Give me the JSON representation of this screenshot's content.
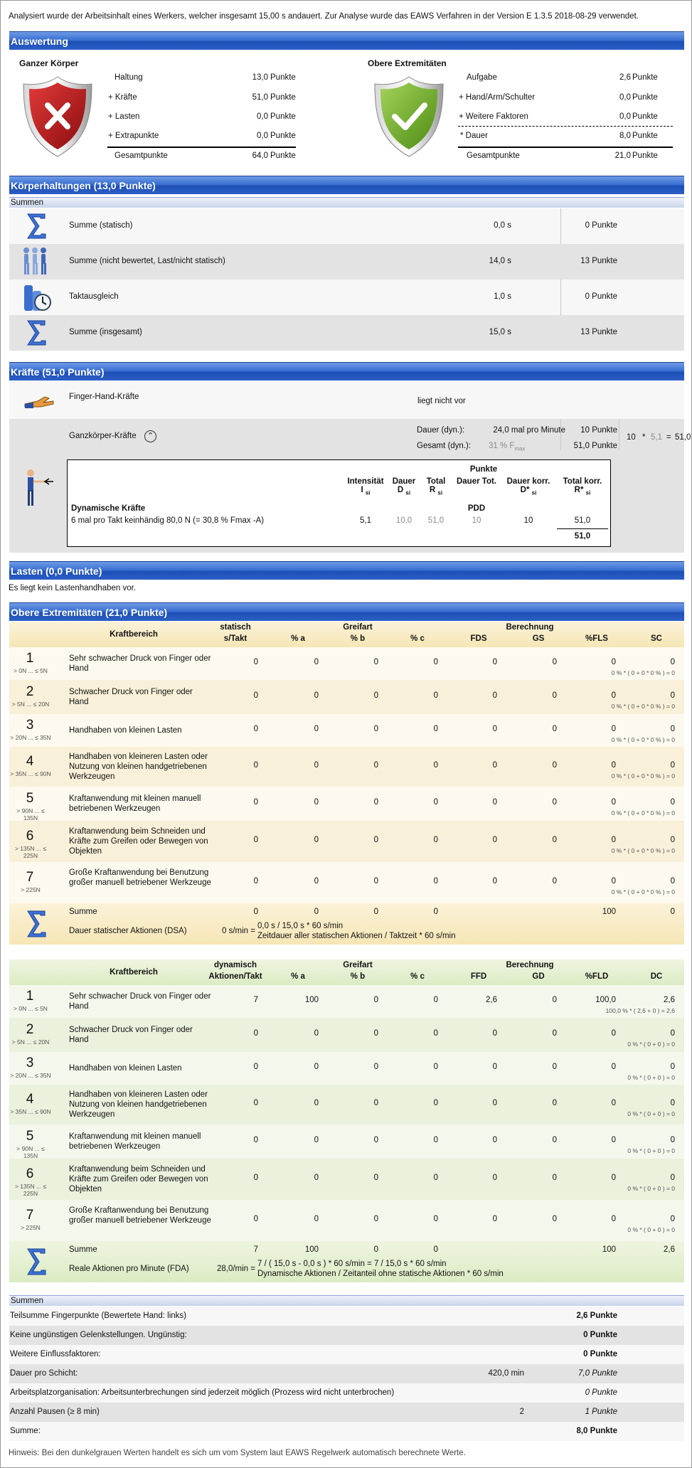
{
  "intro": "Analysiert wurde der Arbeitsinhalt eines Werkers, welcher insgesamt 15,00 s andauert. Zur Analyse wurde das EAWS Verfahren in der Version E 1.3.5 2018-08-29 verwendet.",
  "auswertung": {
    "title": "Auswertung",
    "left_title": "Ganzer Körper",
    "left_rows": [
      {
        "label": "Haltung",
        "value": "13,0",
        "unit": "Punkte"
      },
      {
        "label": "+ Kräfte",
        "value": "51,0",
        "unit": "Punkte"
      },
      {
        "label": "+ Lasten",
        "value": "0,0",
        "unit": "Punkte"
      },
      {
        "label": "+ Extrapunkte",
        "value": "0,0",
        "unit": "Punkte"
      }
    ],
    "left_total": {
      "label": "Gesamtpunkte",
      "value": "64,0",
      "unit": "Punkte"
    },
    "right_title": "Obere Extremitäten",
    "right_rows": [
      {
        "label": "Aufgabe",
        "value": "2,6",
        "unit": "Punkte"
      },
      {
        "label": "+ Hand/Arm/Schulter",
        "value": "0,0",
        "unit": "Punkte"
      },
      {
        "label": "+ Weitere Faktoren",
        "value": "0,0",
        "unit": "Punkte"
      },
      {
        "label": "* Dauer",
        "value": "8,0",
        "unit": "Punkte"
      }
    ],
    "right_total": {
      "label": "Gesamtpunkte",
      "value": "21,0",
      "unit": "Punkte"
    }
  },
  "koerper": {
    "title": "Körperhaltungen (13,0 Punkte)",
    "sub": "Summen",
    "rows": [
      {
        "label": "Summe (statisch)",
        "time": "0,0 s",
        "points": "0 Punkte"
      },
      {
        "label": "Summe (nicht bewertet, Last/nicht statisch)",
        "time": "14,0 s",
        "points": "13 Punkte"
      },
      {
        "label": "Taktausgleich",
        "time": "1,0 s",
        "points": "0 Punkte"
      },
      {
        "label": "Summe (insgesamt)",
        "time": "15,0 s",
        "points": "13 Punkte"
      }
    ]
  },
  "kraefte": {
    "title": "Kräfte (51,0 Punkte)",
    "finger_label": "Finger-Hand-Kräfte",
    "finger_status": "liegt nicht vor",
    "ganz_label": "Ganzkörper-Kräfte",
    "dauer_label": "Dauer (dyn.):",
    "dauer_value": "24,0 mal pro Minute",
    "dauer_points": "10 Punkte",
    "gesamt_label": "Gesamt (dyn.):",
    "gesamt_value": "31 % F",
    "gesamt_sub": "max",
    "gesamt_points": "51,0 Punkte",
    "calc_a": "10",
    "calc_op": "*",
    "calc_b": "5,1",
    "calc_eq": "=",
    "calc_c": "51,0",
    "table": {
      "punkte": "Punkte",
      "headers": [
        {
          "main": "Intensität",
          "sub": "I",
          "subsub": "si"
        },
        {
          "main": "Dauer",
          "sub": "D",
          "subsub": "si"
        },
        {
          "main": "Total",
          "sub": "R",
          "subsub": "si"
        },
        {
          "main": "Dauer Tot.",
          "sub": "",
          "subsub": ""
        },
        {
          "main": "Dauer korr.",
          "sub": "D*",
          "subsub": "si"
        },
        {
          "main": "Total korr.",
          "sub": "R*",
          "subsub": "si"
        }
      ],
      "section": "Dynamische Kräfte",
      "pdd": "PDD",
      "row_label": "6 mal pro Takt keinhändig  80,0 N (= 30,8 % Fmax -A)",
      "row_values": [
        "5,1",
        "10,0",
        "51,0",
        "10",
        "10",
        "51,0"
      ],
      "total": "51,0"
    }
  },
  "lasten": {
    "title": "Lasten (0,0 Punkte)",
    "text": "Es liegt kein Lastenhandhaben vor."
  },
  "obere": {
    "title": "Obere Extremitäten (21,0 Punkte)",
    "static": {
      "h_kraft": "Kraftbereich",
      "h_type_top": "statisch",
      "h_type_bot": "s/Takt",
      "h_greif": "Greifart",
      "h_pa": "% a",
      "h_pb": "% b",
      "h_pc": "% c",
      "h_ber": "Berechnung",
      "h_1": "FDS",
      "h_2": "GS",
      "h_3": "%FLS",
      "h_4": "SC",
      "rows": [
        {
          "n": "1",
          "range": "> 0N ... ≤ 5N",
          "label": "Sehr schwacher Druck von Finger oder Hand",
          "v": [
            "0",
            "0",
            "0",
            "0",
            "0",
            "0",
            "0",
            "0"
          ],
          "formula": "0 % * ( 0 + 0 * 0 % ) = 0"
        },
        {
          "n": "2",
          "range": "> 5N ... ≤ 20N",
          "label": "Schwacher Druck von Finger oder Hand",
          "v": [
            "0",
            "0",
            "0",
            "0",
            "0",
            "0",
            "0",
            "0"
          ],
          "formula": "0 % * ( 0 + 0 * 0 % ) = 0"
        },
        {
          "n": "3",
          "range": "> 20N ... ≤ 35N",
          "label": "Handhaben von kleinen Lasten",
          "v": [
            "0",
            "0",
            "0",
            "0",
            "0",
            "0",
            "0",
            "0"
          ],
          "formula": "0 % * ( 0 + 0 * 0 % ) = 0"
        },
        {
          "n": "4",
          "range": "> 35N ... ≤ 90N",
          "label": "Handhaben von kleineren Lasten oder Nutzung von kleinen handgetriebenen Werkzeugen",
          "v": [
            "0",
            "0",
            "0",
            "0",
            "0",
            "0",
            "0",
            "0"
          ],
          "formula": "0 % * ( 0 + 0 * 0 % ) = 0"
        },
        {
          "n": "5",
          "range": "> 90N ... ≤ 135N",
          "label": "Kraftanwendung mit kleinen manuell betriebenen Werkzeugen",
          "v": [
            "0",
            "0",
            "0",
            "0",
            "0",
            "0",
            "0",
            "0"
          ],
          "formula": "0 % * ( 0 + 0 * 0 % ) = 0"
        },
        {
          "n": "6",
          "range": "> 135N ... ≤ 225N",
          "label": "Kraftanwendung beim Schneiden und Kräfte zum Greifen oder Bewegen von Objekten",
          "v": [
            "0",
            "0",
            "0",
            "0",
            "0",
            "0",
            "0",
            "0"
          ],
          "formula": "0 % * ( 0 + 0 * 0 % ) = 0"
        },
        {
          "n": "7",
          "range": "> 225N",
          "label": "Große Kraftanwendung bei Benutzung großer manuell betriebener Werkzeuge",
          "v": [
            "0",
            "0",
            "0",
            "0",
            "0",
            "0",
            "0",
            "0"
          ],
          "formula": "0 % * ( 0 + 0 * 0 % ) = 0"
        }
      ],
      "sum_label": "Summe",
      "sum_v": [
        "0",
        "0",
        "0",
        "0",
        "100",
        "0"
      ],
      "foot_label": "Dauer statischer Aktionen (DSA)",
      "foot_val": "0 s/min =",
      "foot_l1": "0,0 s / 15,0 s * 60 s/min",
      "foot_l2": "Zeitdauer aller statischen Aktionen / Taktzeit * 60 s/min"
    },
    "dynamic": {
      "h_kraft": "Kraftbereich",
      "h_type_top": "dynamisch",
      "h_type_bot": "Aktionen/Takt",
      "h_greif": "Greifart",
      "h_pa": "% a",
      "h_pb": "% b",
      "h_pc": "% c",
      "h_ber": "Berechnung",
      "h_1": "FFD",
      "h_2": "GD",
      "h_3": "%FLD",
      "h_4": "DC",
      "rows": [
        {
          "n": "1",
          "range": "> 0N ... ≤ 5N",
          "label": "Sehr schwacher Druck von Finger oder Hand",
          "v": [
            "7",
            "100",
            "0",
            "0",
            "2,6",
            "0",
            "100,0",
            "2,6"
          ],
          "formula": "100,0 % * ( 2,6 + 0 ) = 2,6"
        },
        {
          "n": "2",
          "range": "> 5N ... ≤ 20N",
          "label": "Schwacher Druck von Finger oder Hand",
          "v": [
            "0",
            "0",
            "0",
            "0",
            "0",
            "0",
            "0",
            "0"
          ],
          "formula": "0 % * ( 0 + 0 ) = 0"
        },
        {
          "n": "3",
          "range": "> 20N ... ≤ 35N",
          "label": "Handhaben von kleinen Lasten",
          "v": [
            "0",
            "0",
            "0",
            "0",
            "0",
            "0",
            "0",
            "0"
          ],
          "formula": "0 % * ( 0 + 0 ) = 0"
        },
        {
          "n": "4",
          "range": "> 35N ... ≤ 90N",
          "label": "Handhaben von kleineren Lasten oder Nutzung von kleinen handgetriebenen Werkzeugen",
          "v": [
            "0",
            "0",
            "0",
            "0",
            "0",
            "0",
            "0",
            "0"
          ],
          "formula": "0 % * ( 0 + 0 ) = 0"
        },
        {
          "n": "5",
          "range": "> 90N ... ≤ 135N",
          "label": "Kraftanwendung mit kleinen manuell betriebenen Werkzeugen",
          "v": [
            "0",
            "0",
            "0",
            "0",
            "0",
            "0",
            "0",
            "0"
          ],
          "formula": "0 % * ( 0 + 0 ) = 0"
        },
        {
          "n": "6",
          "range": "> 135N ... ≤ 225N",
          "label": "Kraftanwendung beim Schneiden und Kräfte zum Greifen oder Bewegen von Objekten",
          "v": [
            "0",
            "0",
            "0",
            "0",
            "0",
            "0",
            "0",
            "0"
          ],
          "formula": "0 % * ( 0 + 0 ) = 0"
        },
        {
          "n": "7",
          "range": "> 225N",
          "label": "Große Kraftanwendung bei Benutzung großer manuell betriebener Werkzeuge",
          "v": [
            "0",
            "0",
            "0",
            "0",
            "0",
            "0",
            "0",
            "0"
          ],
          "formula": "0 % * ( 0 + 0 ) = 0"
        }
      ],
      "sum_label": "Summe",
      "sum_v": [
        "7",
        "100",
        "0",
        "0",
        "100",
        "2,6"
      ],
      "foot_label": "Reale Aktionen pro Minute (FDA)",
      "foot_val": "28,0/min =",
      "foot_l1": "7 / ( 15,0 s - 0,0 s ) * 60 s/min = 7 / 15,0 s * 60 s/min",
      "foot_l2": "Dynamische Aktionen / Zeitanteil ohne statische Aktionen * 60 s/min"
    },
    "summen": {
      "title": "Summen",
      "rows": [
        {
          "label": "Teilsumme Fingerpunkte (Bewertete Hand: links)",
          "mid": "",
          "val": "2,6 Punkte",
          "style": "bold"
        },
        {
          "label": "Keine ungünstigen Gelenkstellungen. Ungünstig:",
          "mid": "",
          "val": "0 Punkte",
          "style": "bold"
        },
        {
          "label": "Weitere Einflussfaktoren:",
          "mid": "",
          "val": "0 Punkte",
          "style": "bold"
        },
        {
          "label": "Dauer pro Schicht:",
          "mid": "420,0 min",
          "val": "7,0 Punkte",
          "style": "italic"
        },
        {
          "label": "Arbeitsplatzorganisation: Arbeitsunterbrechungen sind jederzeit möglich (Prozess wird nicht unterbrochen)",
          "mid": "",
          "val": "0 Punkte",
          "style": "italic"
        },
        {
          "label": "Anzahl Pausen (≥ 8 min)",
          "mid": "2",
          "val": "1 Punkte",
          "style": "italic"
        },
        {
          "label": "Summe:",
          "mid": "",
          "val": "8,0 Punkte",
          "style": "bold"
        }
      ]
    },
    "hint": "Hinweis: Bei den dunkelgrauen Werten handelt es sich um vom System laut EAWS Regelwerk automatisch berechnete Werte."
  }
}
